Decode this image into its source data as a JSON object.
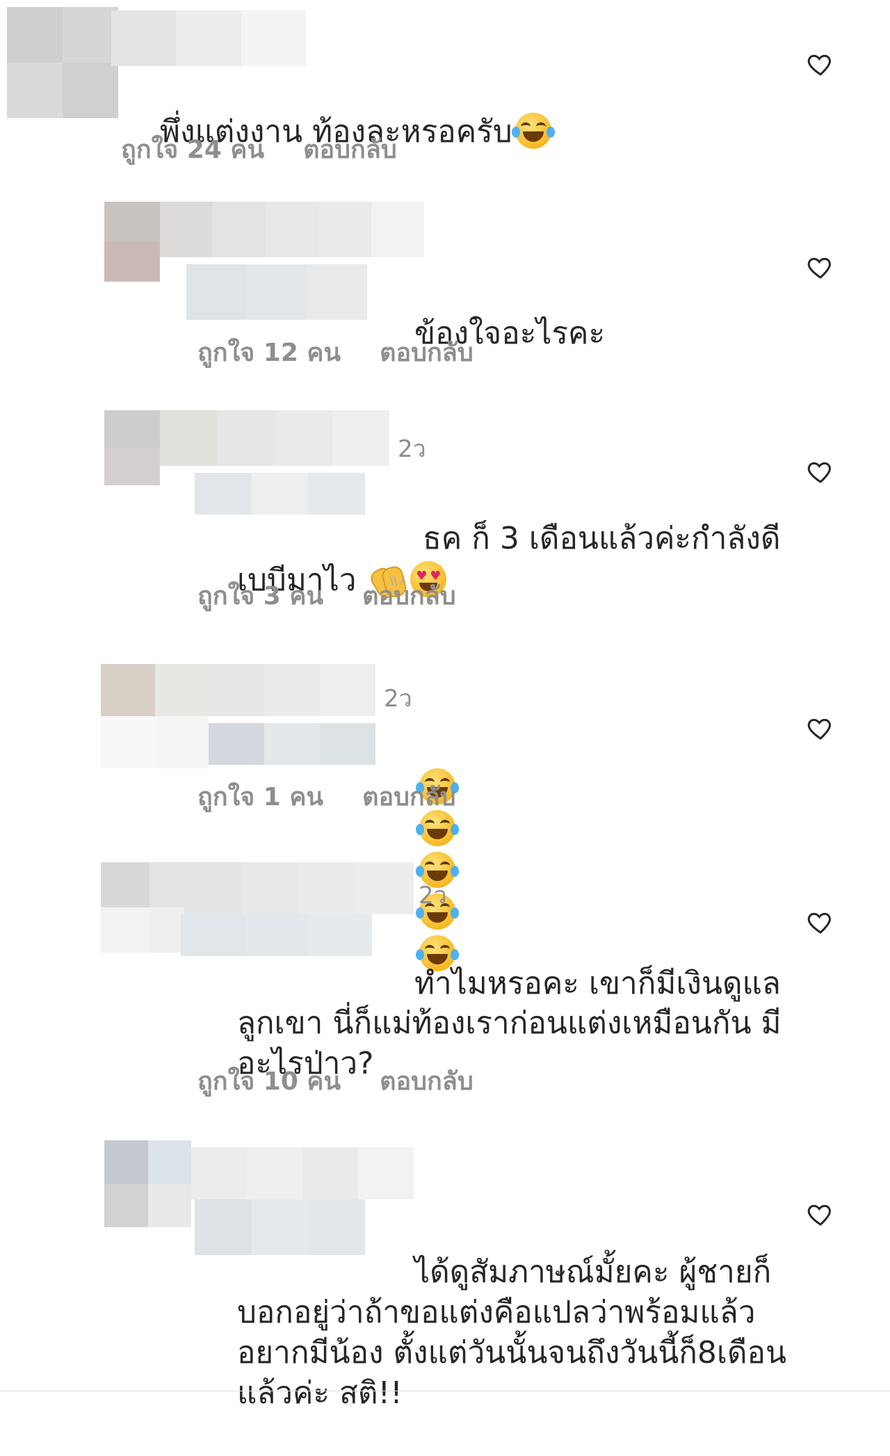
{
  "comments": [
    {
      "text": "พึ่งแต่งงาน ท้องละหรอครับ",
      "time": "",
      "likes": "ถูกใจ 24 คน",
      "reply": "ตอบกลับ"
    },
    {
      "text": "ข้องใจอะไรคะ",
      "time": "",
      "likes": "ถูกใจ 12 คน",
      "reply": "ตอบกลับ"
    },
    {
      "text_line1": "ธค ก็ 3 เดือนแล้วค่ะกำลังดี",
      "text_line2": "เบบีมาไว",
      "time": "2ว",
      "likes": "ถูกใจ 3 คน",
      "reply": "ตอบกลับ"
    },
    {
      "time": "2ว",
      "likes": "ถูกใจ 1 คน",
      "reply": "ตอบกลับ"
    },
    {
      "text_line1": "ทำไมหรอคะ เขาก็มีเงินดูแล",
      "text_line2": "ลูกเขา นี่ก็แม่ท้องเราก่อนแต่งเหมือนกัน มี",
      "text_line3": "อะไรป่าว?",
      "time": "2ว",
      "likes": "ถูกใจ 10 คน",
      "reply": "ตอบกลับ"
    },
    {
      "text_line1": "ได้ดูสัมภาษณ์มั้ยคะ ผู้ชายก็",
      "text_line2": "บอกอยู่ว่าถ้าขอแต่งคือแปลว่าพร้อมแล้ว",
      "text_line3": "อยากมีน้อง ตั้งแต่วันนั้นจนถึงวันนี้ก็8เดือน",
      "text_line4": "แล้วค่ะ สติ!!"
    }
  ],
  "icons": {
    "like": "heart-outline-icon",
    "emoji_joy": "face-with-tears-of-joy-icon",
    "emoji_hearts": "heart-eyes-face-icon",
    "emoji_clap": "clapping-hands-icon"
  },
  "colors": {
    "text": "#262626",
    "secondary": "#8e8e8e",
    "divider": "#dbdbdb"
  }
}
